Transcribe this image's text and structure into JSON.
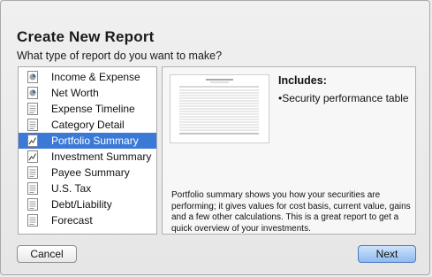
{
  "dialog": {
    "title": "Create New Report",
    "subtitle": "What type of report do you want to make?"
  },
  "report_types": [
    {
      "label": "Income & Expense",
      "icon": "pie-chart-icon"
    },
    {
      "label": "Net Worth",
      "icon": "pie-chart-icon"
    },
    {
      "label": "Expense Timeline",
      "icon": "document-icon"
    },
    {
      "label": "Category Detail",
      "icon": "document-icon"
    },
    {
      "label": "Portfolio Summary",
      "icon": "line-chart-icon",
      "selected": true
    },
    {
      "label": "Investment Summary",
      "icon": "line-chart-icon"
    },
    {
      "label": "Payee Summary",
      "icon": "document-icon"
    },
    {
      "label": "U.S. Tax",
      "icon": "document-icon"
    },
    {
      "label": "Debt/Liability",
      "icon": "document-icon"
    },
    {
      "label": "Forecast",
      "icon": "document-icon"
    }
  ],
  "details": {
    "includes_heading": "Includes:",
    "includes_items": [
      "•Security performance table"
    ],
    "description": "Portfolio summary shows you how your securities are performing; it gives values for cost basis, current value, gains and a few other calculations. This is a great report to get a quick overview of your investments."
  },
  "buttons": {
    "cancel": "Cancel",
    "next": "Next"
  },
  "colors": {
    "selection": "#3a79d6",
    "primary_button": "#8fbaf0"
  }
}
